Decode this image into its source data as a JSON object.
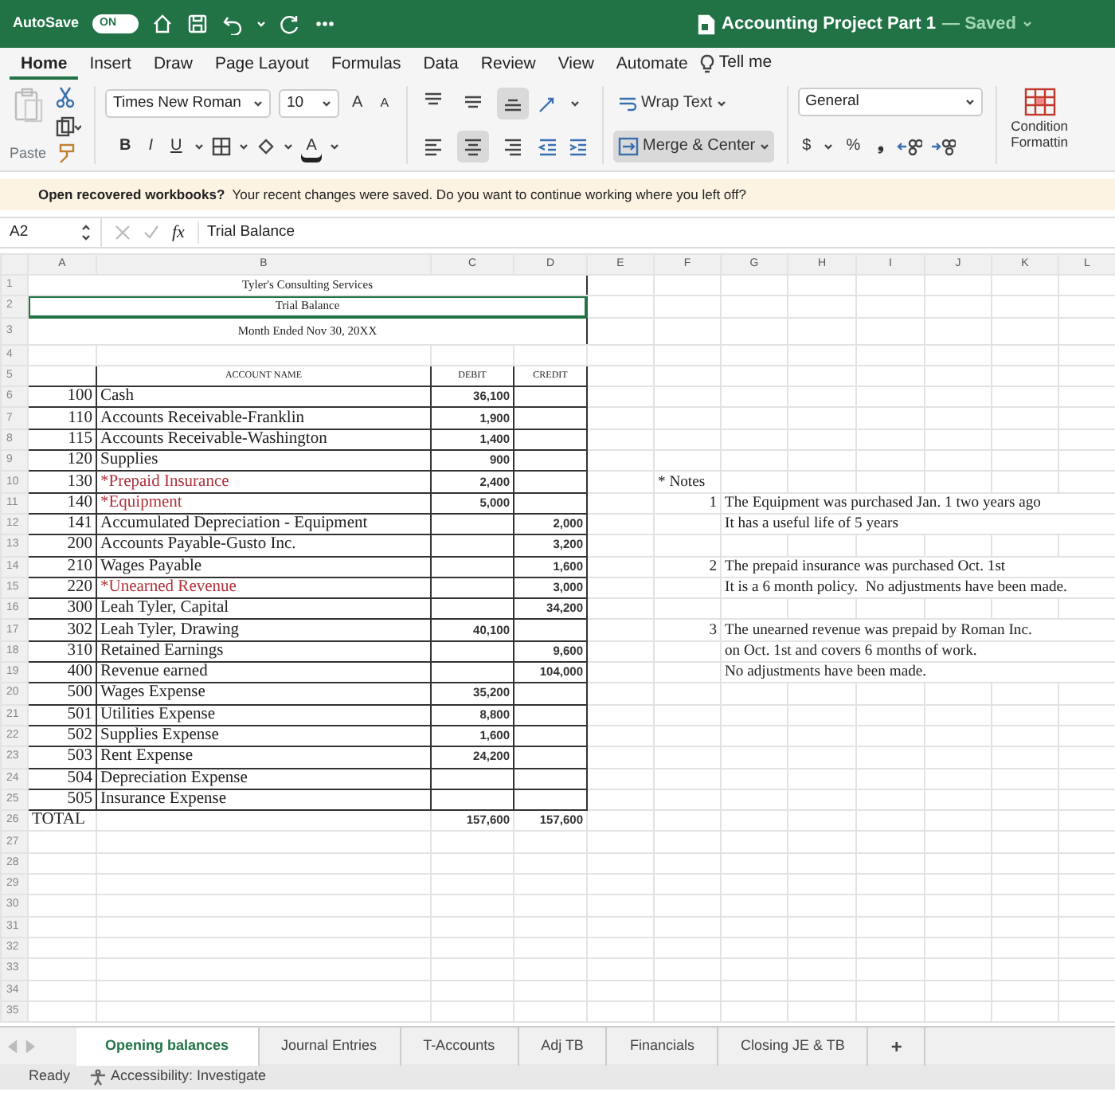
{
  "title_bar": {
    "autosave_label": "AutoSave",
    "autosave_toggle": "ON",
    "autosave_on": true,
    "document_title": "Accounting Project Part 1",
    "save_status": "— Saved"
  },
  "ribbon_tabs": [
    {
      "label": "Home",
      "selected": true
    },
    {
      "label": "Insert",
      "selected": false
    },
    {
      "label": "Draw",
      "selected": false
    },
    {
      "label": "Page Layout",
      "selected": false
    },
    {
      "label": "Formulas",
      "selected": false
    },
    {
      "label": "Data",
      "selected": false
    },
    {
      "label": "Review",
      "selected": false
    },
    {
      "label": "View",
      "selected": false
    },
    {
      "label": "Automate",
      "selected": false
    }
  ],
  "tell_me": "Tell me",
  "ribbon": {
    "paste_label": "Paste",
    "font_name": "Times New Roman",
    "font_size": "10",
    "grow_font": "A",
    "shrink_font": "A",
    "bold": "B",
    "italic": "I",
    "underline": "U",
    "font_color": "A",
    "alignment_buttons": [
      {
        "kind": "top",
        "selected": false
      },
      {
        "kind": "middle",
        "selected": false
      },
      {
        "kind": "bottom",
        "selected": true
      },
      {
        "kind": "left",
        "selected": false
      },
      {
        "kind": "center",
        "selected": true
      },
      {
        "kind": "right",
        "selected": false
      }
    ],
    "wrap_text": "Wrap Text",
    "merge_center": "Merge & Center",
    "merge_center_selected": true,
    "number_format": "General",
    "currency": "$",
    "percent": "%",
    "comma": "❟",
    "conditional_formatting": [
      "Condition",
      "Formattin"
    ]
  },
  "message_bar": {
    "question": "Open recovered workbooks?",
    "text": "Your recent changes were saved. Do you want to continue working where you left off?"
  },
  "formula_bar": {
    "cell_ref": "A2",
    "function_label": "fx",
    "formula": "Trial Balance"
  },
  "columns": [
    "A",
    "B",
    "C",
    "D",
    "E",
    "F",
    "G",
    "H",
    "I",
    "J",
    "K",
    "L"
  ],
  "row_numbers": [
    "1",
    "2",
    "3",
    "4",
    "5",
    "6",
    "7",
    "8",
    "9",
    "10",
    "11",
    "12",
    "13",
    "14",
    "15",
    "16",
    "17",
    "18",
    "19",
    "20",
    "21",
    "22",
    "23",
    "24",
    "25",
    "26",
    "27",
    "28",
    "29",
    "30",
    "31",
    "32",
    "33",
    "34",
    "35"
  ],
  "report_header": [
    {
      "text": "Tyler's Consulting Services",
      "selected": false
    },
    {
      "text": "Trial Balance",
      "selected": true
    },
    {
      "text": "Month Ended Nov 30, 20XX",
      "selected": false
    }
  ],
  "table_header": {
    "account_name": "ACCOUNT NAME",
    "debit": "DEBIT",
    "credit": "CREDIT"
  },
  "accounts": [
    {
      "number": "100",
      "name": "Cash",
      "flagged": false,
      "debit": "36,100"
    },
    {
      "number": "110",
      "name": "Accounts Receivable-Franklin",
      "flagged": false,
      "debit": "1,900"
    },
    {
      "number": "115",
      "name": "Accounts Receivable-Washington",
      "flagged": false,
      "debit": "1,400"
    },
    {
      "number": "120",
      "name": "Supplies",
      "flagged": false,
      "debit": "900"
    },
    {
      "number": "130",
      "name": "*Prepaid Insurance",
      "flagged": true,
      "debit": "2,400"
    },
    {
      "number": "140",
      "name": "*Equipment",
      "flagged": true,
      "debit": "5,000"
    },
    {
      "number": "141",
      "name": "Accumulated Depreciation - Equipment",
      "flagged": false,
      "credit": "2,000"
    },
    {
      "number": "200",
      "name": "Accounts Payable-Gusto Inc.",
      "flagged": false,
      "credit": "3,200"
    },
    {
      "number": "210",
      "name": "Wages Payable",
      "flagged": false,
      "credit": "1,600"
    },
    {
      "number": "220",
      "name": "*Unearned Revenue",
      "flagged": true,
      "credit": "3,000"
    },
    {
      "number": "300",
      "name": "Leah Tyler, Capital",
      "flagged": false,
      "credit": "34,200"
    },
    {
      "number": "302",
      "name": "Leah Tyler, Drawing",
      "flagged": false,
      "debit": "40,100"
    },
    {
      "number": "310",
      "name": "Retained Earnings",
      "flagged": false,
      "credit": "9,600"
    },
    {
      "number": "400",
      "name": "Revenue earned",
      "flagged": false,
      "credit": "104,000"
    },
    {
      "number": "500",
      "name": "Wages Expense",
      "flagged": false,
      "debit": "35,200"
    },
    {
      "number": "501",
      "name": "Utilities Expense",
      "flagged": false,
      "debit": "8,800"
    },
    {
      "number": "502",
      "name": "Supplies Expense",
      "flagged": false,
      "debit": "1,600"
    },
    {
      "number": "503",
      "name": "Rent Expense",
      "flagged": false,
      "debit": "24,200"
    },
    {
      "number": "504",
      "name": "Depreciation Expense",
      "flagged": false
    },
    {
      "number": "505",
      "name": "Insurance Expense",
      "flagged": false
    }
  ],
  "total": {
    "label": "TOTAL",
    "debit": "157,600",
    "credit": "157,600"
  },
  "notes": {
    "heading": "* Notes",
    "items": [
      {
        "number": "1",
        "lines": [
          "The Equipment was purchased Jan. 1 two years ago",
          "It has a useful life of 5 years"
        ]
      },
      {
        "number": "2",
        "lines": [
          "The prepaid insurance was purchased Oct. 1st",
          "It is a 6 month policy.  No adjustments have been made."
        ]
      },
      {
        "number": "3",
        "lines": [
          "The unearned revenue was prepaid by Roman Inc.",
          "on Oct. 1st and covers 6 months of work.",
          "No adjustments have been made."
        ]
      }
    ]
  },
  "sheet_tabs": [
    {
      "label": "Opening balances",
      "selected": true
    },
    {
      "label": "Journal Entries",
      "selected": false
    },
    {
      "label": "T-Accounts",
      "selected": false
    },
    {
      "label": "Adj TB",
      "selected": false
    },
    {
      "label": "Financials",
      "selected": false
    },
    {
      "label": "Closing JE & TB",
      "selected": false
    }
  ],
  "add_sheet": "+",
  "status_bar": {
    "ready": "Ready",
    "accessibility": "Accessibility: Investigate"
  }
}
